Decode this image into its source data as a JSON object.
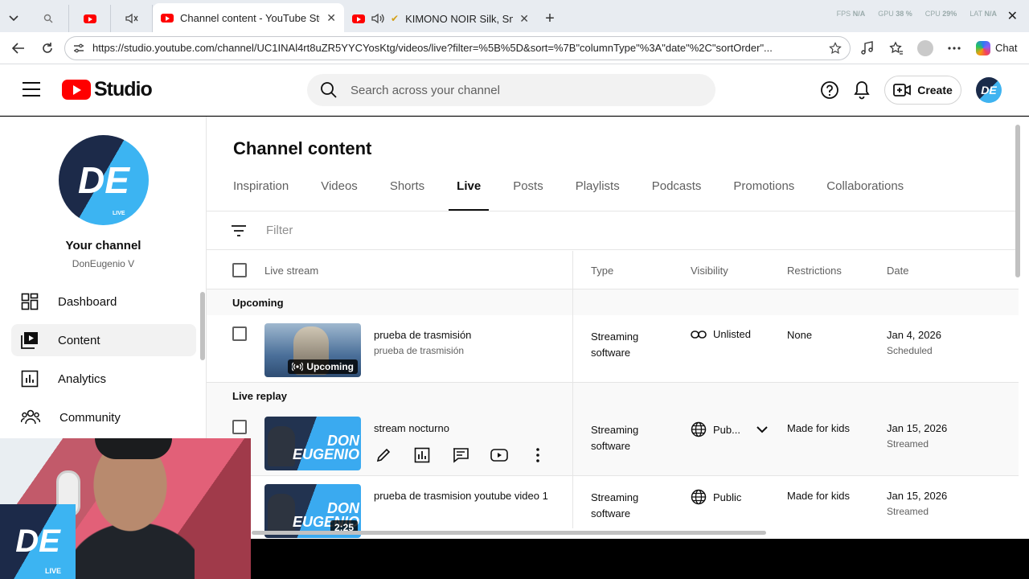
{
  "browser": {
    "tabs": [
      {
        "title": "Channel content - YouTube Studio",
        "active": true
      },
      {
        "title": "KIMONO NOIR Silk, Smok",
        "active": false
      }
    ],
    "perf": {
      "fps_label": "FPS",
      "fps": "N/A",
      "gpu_label": "GPU",
      "gpu": "38 %",
      "cpu_label": "CPU",
      "cpu": "29%",
      "lat_label": "LAT",
      "lat": "N/A"
    },
    "url": "https://studio.youtube.com/channel/UC1INAl4rt8uZR5YYCYosKtg/videos/live?filter=%5B%5D&sort=%7B\"columnType\"%3A\"date\"%2C\"sortOrder\"...",
    "chat_label": "Chat"
  },
  "header": {
    "logo_text": "Studio",
    "search_placeholder": "Search across your channel",
    "create_label": "Create"
  },
  "sidebar": {
    "channel_title": "Your channel",
    "channel_name": "DonEugenio V",
    "avatar_initials": "DE",
    "avatar_live": "LIVE",
    "items": [
      {
        "label": "Dashboard",
        "icon": "dashboard-icon"
      },
      {
        "label": "Content",
        "icon": "content-icon",
        "active": true
      },
      {
        "label": "Analytics",
        "icon": "analytics-icon"
      },
      {
        "label": "Community",
        "icon": "community-icon"
      }
    ]
  },
  "main": {
    "title": "Channel content",
    "tabs": [
      "Inspiration",
      "Videos",
      "Shorts",
      "Live",
      "Posts",
      "Playlists",
      "Podcasts",
      "Promotions",
      "Collaborations"
    ],
    "active_tab": "Live",
    "filter_placeholder": "Filter",
    "columns": {
      "stream": "Live stream",
      "type": "Type",
      "visibility": "Visibility",
      "restrictions": "Restrictions",
      "date": "Date"
    },
    "sections": {
      "upcoming": "Upcoming",
      "replay": "Live replay"
    },
    "rows": [
      {
        "title": "prueba de trasmisión",
        "description": "prueba de trasmisión",
        "badge": "Upcoming",
        "type_line1": "Streaming",
        "type_line2": "software",
        "visibility": "Unlisted",
        "restrictions": "None",
        "date": "Jan 4, 2026",
        "status": "Scheduled"
      },
      {
        "title": "stream nocturno",
        "thumb_name_line1": "DON",
        "thumb_name_line2": "EUGENIO",
        "type_line1": "Streaming",
        "type_line2": "software",
        "visibility": "Pub...",
        "restrictions": "Made for kids",
        "date": "Jan 15, 2026",
        "status": "Streamed"
      },
      {
        "title": "prueba de trasmision youtube video 1",
        "thumb_name_line1": "DON",
        "thumb_name_line2": "EUGENIO",
        "badge": "2:25",
        "type_line1": "Streaming",
        "type_line2": "software",
        "visibility": "Public",
        "restrictions": "Made for kids",
        "date": "Jan 15, 2026",
        "status": "Streamed"
      }
    ]
  },
  "webcam": {
    "logo_initials": "DE",
    "logo_live": "LIVE"
  }
}
